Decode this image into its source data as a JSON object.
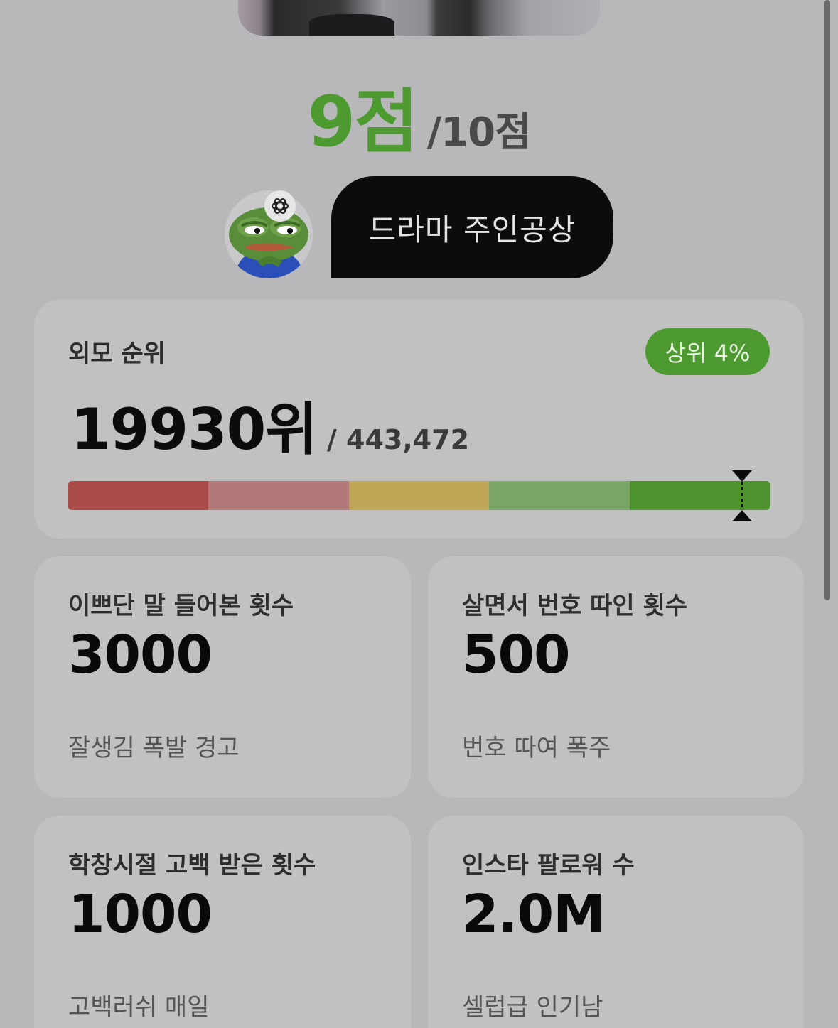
{
  "score": {
    "value": "9점",
    "max": "/10점"
  },
  "profile": {
    "avatar_icon": "pepe-avatar",
    "badge_icon": "openai-logo",
    "title": "드라마 주인공상"
  },
  "ranking": {
    "title": "외모 순위",
    "badge": "상위 4%",
    "rank": "19930위",
    "total": "/ 443,472",
    "position_percentile": 96,
    "segment_colors": [
      "#a94b48",
      "#b17a78",
      "#bfa556",
      "#7ba567",
      "#4d9430"
    ]
  },
  "stats": [
    {
      "title": "이쁘단 말 들어본 횟수",
      "value": "3000",
      "caption": "잘생김 폭발 경고"
    },
    {
      "title": "살면서 번호 따인 횟수",
      "value": "500",
      "caption": "번호 따여 폭주"
    },
    {
      "title": "학창시절 고백 받은 횟수",
      "value": "1000",
      "caption": "고백러쉬 매일"
    },
    {
      "title": "인스타 팔로워 수",
      "value": "2.0M",
      "caption": "셀럽급 인기남"
    }
  ],
  "colors": {
    "accent": "#4d9a30",
    "card": "#c1c1c1",
    "background": "#b8b8ba"
  }
}
